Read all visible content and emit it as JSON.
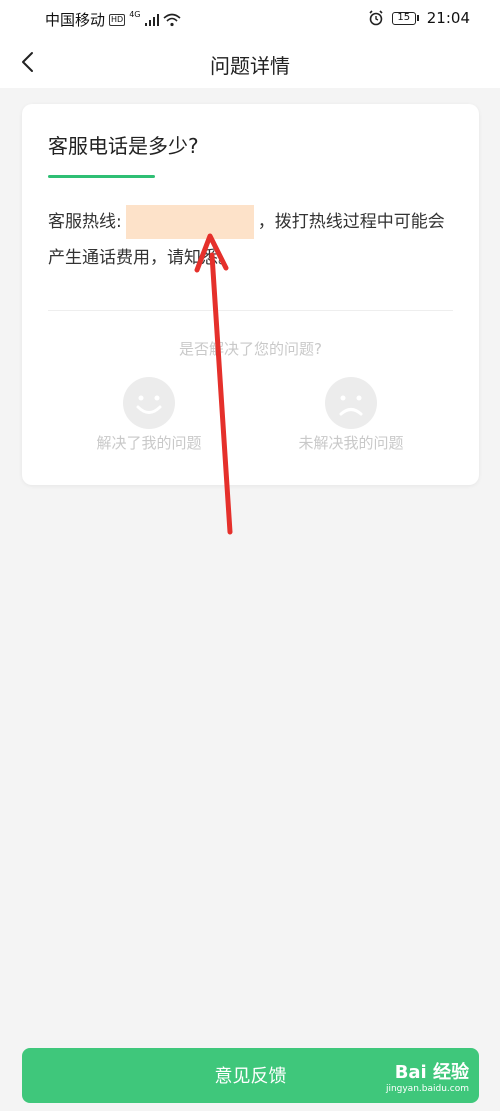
{
  "status_bar": {
    "carrier": "中国移动",
    "hd": "HD",
    "network": "4G",
    "battery": "15",
    "time": "21:04"
  },
  "nav": {
    "title": "问题详情"
  },
  "card": {
    "question": "客服电话是多少?",
    "answer_prefix": "客服热线:",
    "answer_suffix": "，拨打热线过程中可能会产生通话费用，请知悉。",
    "feedback_question": "是否解决了您的问题?",
    "solved_label": "解决了我的问题",
    "unsolved_label": "未解决我的问题"
  },
  "bottom": {
    "feedback_button": "意见反馈",
    "watermark_main": "Bai 经验",
    "watermark_sub": "jingyan.baidu.com"
  },
  "colors": {
    "accent": "#2fbf74",
    "button": "#3fc77b",
    "arrow": "#e5302b",
    "redaction": "#fde2c9"
  }
}
